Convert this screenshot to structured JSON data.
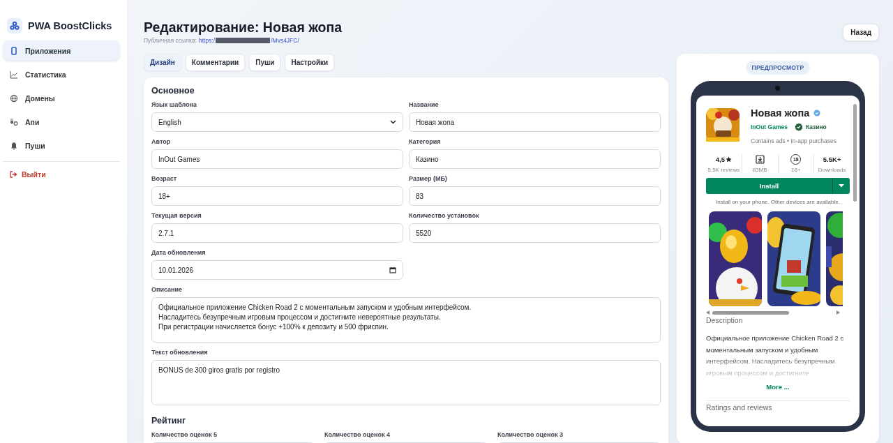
{
  "sidebar": {
    "brand": "PWA BoostClicks",
    "items": [
      {
        "label": "Приложения",
        "selected": true
      },
      {
        "label": "Статистика",
        "selected": false
      },
      {
        "label": "Домены",
        "selected": false
      },
      {
        "label": "Апи",
        "selected": false
      },
      {
        "label": "Пуши",
        "selected": false
      }
    ],
    "logout": "Выйти"
  },
  "header": {
    "title": "Редактирование: Новая жопа",
    "link_label": "Публичная ссылка:",
    "link_start": "https:/",
    "link_end": "/Mvs4JFC/"
  },
  "back_button": "Назад",
  "tabs": [
    {
      "label": "Дизайн",
      "selected": true
    },
    {
      "label": "Комментарии",
      "selected": false
    },
    {
      "label": "Пуши",
      "selected": false
    },
    {
      "label": "Настройки",
      "selected": false
    }
  ],
  "main_section": {
    "title": "Основное",
    "fields": [
      {
        "label": "Язык шаблона",
        "kind": "select",
        "value": "English"
      },
      {
        "label": "Название",
        "kind": "text",
        "value": "Новая жопа"
      },
      {
        "label": "Автор",
        "kind": "text",
        "value": "InOut Games"
      },
      {
        "label": "Категория",
        "kind": "text",
        "value": "Казино"
      },
      {
        "label": "Возраст",
        "kind": "text",
        "value": "18+"
      },
      {
        "label": "Размер (МБ)",
        "kind": "text",
        "value": "83"
      },
      {
        "label": "Текущая версия",
        "kind": "text",
        "value": "2.7.1"
      },
      {
        "label": "Количество установок",
        "kind": "text",
        "value": "5520"
      },
      {
        "label": "Дата обновления",
        "kind": "date",
        "value": "10.01.2026"
      },
      {
        "label": "Описание",
        "kind": "textarea",
        "value": "Официальное приложение Chicken Road 2 с моментальным запуском и удобным интерфейсом.\nНасладитесь безупречным игровым процессом и достигните невероятные результаты.\nПри регистрации начисляется бонус +100% к депозиту и 500 фриспин."
      },
      {
        "label": "Текст обновления",
        "kind": "textarea",
        "value": "BONUS de 300 giros gratis por registro"
      }
    ]
  },
  "rating_section": {
    "title": "Рейтинг",
    "fields": [
      {
        "label": "Количество оценок 5"
      },
      {
        "label": "Количество оценок 4"
      },
      {
        "label": "Количество оценок 3"
      }
    ]
  },
  "preview": {
    "badge": "ПРЕДПРОСМОТР",
    "app_name": "Новая жопа",
    "developer": "InOut Games",
    "category": "Казино",
    "notice": "Contains ads • In-app purchases",
    "stats": [
      {
        "kind": "rating",
        "value": "4,5",
        "caption": "5.5K reviews"
      },
      {
        "kind": "download",
        "caption": "83MB"
      },
      {
        "kind": "age",
        "value": "18",
        "caption": "18+"
      },
      {
        "kind": "text",
        "value": "5.5K+",
        "caption": "Downloads"
      }
    ],
    "install_button": "Install",
    "install_note": "Install on your phone. Other devices are available.",
    "description_title": "Description",
    "description": "Официальное приложение Chicken Road 2 с моментальным запуском и удобным интерфейсом. Насладитесь безупречным игровым процессом и достигните",
    "more_link": "More ...",
    "ratings_title": "Ratings and reviews"
  }
}
